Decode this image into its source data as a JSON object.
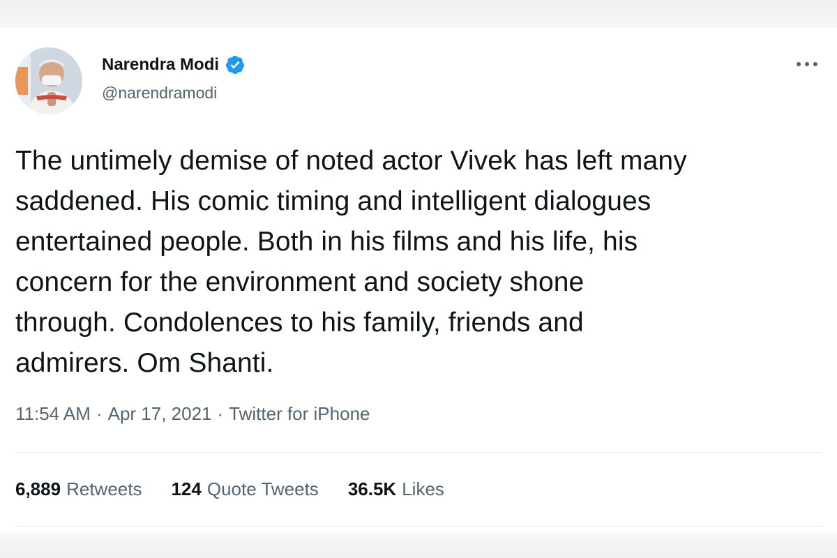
{
  "tweet": {
    "author": {
      "name": "Narendra Modi",
      "handle": "@narendramodi",
      "verified": true,
      "avatar_icon": "profile-photo"
    },
    "text": "The untimely demise of noted actor Vivek has left many\nsaddened. His comic timing and intelligent dialogues\nentertained people. Both in his films and his life, his\nconcern for the environment and society shone\nthrough. Condolences to his family, friends and\nadmirers. Om Shanti.",
    "time": "11:54 AM",
    "separator": "·",
    "date": "Apr 17, 2021",
    "source": "Twitter for iPhone",
    "stats": {
      "retweets": {
        "count": "6,889",
        "label": "Retweets"
      },
      "quotes": {
        "count": "124",
        "label": "Quote Tweets"
      },
      "likes": {
        "count": "36.5K",
        "label": "Likes"
      }
    }
  },
  "colors": {
    "text_primary": "#0f1419",
    "text_secondary": "#536471",
    "verified_blue": "#1d9bf0",
    "divider": "#e7e9ea"
  }
}
